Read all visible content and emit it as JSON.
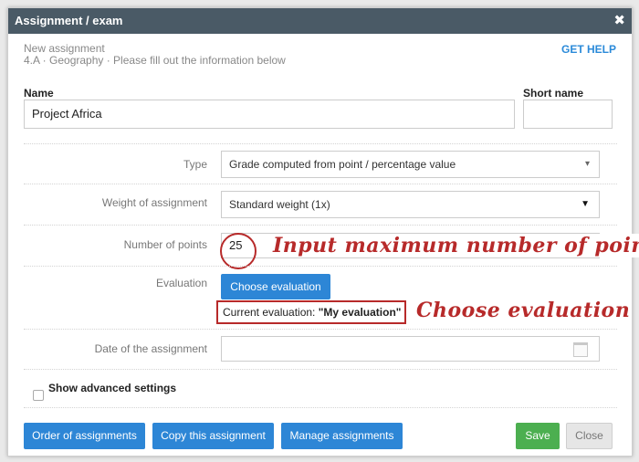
{
  "dialog": {
    "title": "Assignment / exam",
    "close_glyph": "✖",
    "subtitle_line1": "New assignment",
    "subtitle_line2": "4.A · Geography · Please fill out the information below",
    "help_label": "GET HELP"
  },
  "fields": {
    "name_label": "Name",
    "name_value": "Project Africa",
    "short_name_label": "Short name",
    "short_name_value": "",
    "type_label": "Type",
    "type_value": "Grade computed from point / percentage value",
    "weight_label": "Weight of assignment",
    "weight_value": "Standard weight (1x)",
    "points_label": "Number of points",
    "points_value": "25",
    "evaluation_label": "Evaluation",
    "choose_evaluation_button": "Choose evaluation",
    "current_evaluation_prefix": "Current evaluation: ",
    "current_evaluation_value": "\"My evaluation\"",
    "date_label": "Date of the assignment",
    "date_value": "",
    "advanced_label": "Show advanced settings"
  },
  "annotations": {
    "points_note": "Input maximum number of points",
    "evaluation_note": "Choose evaluation",
    "color": "#b72a2a"
  },
  "footer": {
    "order_button": "Order of assignments",
    "copy_button": "Copy this assignment",
    "manage_button": "Manage assignments",
    "save_button": "Save",
    "close_button": "Close"
  },
  "icons": {
    "type_arrow": "▾",
    "weight_arrow": "▼",
    "calendar": "calendar-icon"
  }
}
